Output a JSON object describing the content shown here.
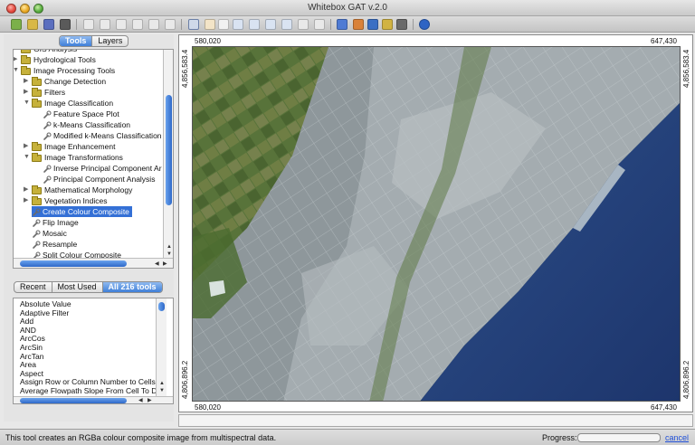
{
  "window": {
    "title": "Whitebox GAT v.2.0"
  },
  "tabs": {
    "tools": "Tools",
    "layers": "Layers",
    "active": "tools"
  },
  "tree": [
    {
      "label": "GIS Analysis",
      "indent": 0,
      "kind": "folder",
      "state": "collapsed"
    },
    {
      "label": "Hydrological Tools",
      "indent": 0,
      "kind": "folder",
      "state": "collapsed"
    },
    {
      "label": "Image Processing Tools",
      "indent": 0,
      "kind": "folder",
      "state": "expanded"
    },
    {
      "label": "Change Detection",
      "indent": 1,
      "kind": "folder",
      "state": "collapsed"
    },
    {
      "label": "Filters",
      "indent": 1,
      "kind": "folder",
      "state": "collapsed"
    },
    {
      "label": "Image Classification",
      "indent": 1,
      "kind": "folder",
      "state": "expanded"
    },
    {
      "label": "Feature Space Plot",
      "indent": 2,
      "kind": "tool"
    },
    {
      "label": "k-Means Classification",
      "indent": 2,
      "kind": "tool"
    },
    {
      "label": "Modified k-Means Classification",
      "indent": 2,
      "kind": "tool"
    },
    {
      "label": "Image Enhancement",
      "indent": 1,
      "kind": "folder",
      "state": "collapsed"
    },
    {
      "label": "Image Transformations",
      "indent": 1,
      "kind": "folder",
      "state": "expanded"
    },
    {
      "label": "Inverse Principal Component Ar",
      "indent": 2,
      "kind": "tool"
    },
    {
      "label": "Principal Component Analysis",
      "indent": 2,
      "kind": "tool"
    },
    {
      "label": "Mathematical Morphology",
      "indent": 1,
      "kind": "folder",
      "state": "collapsed"
    },
    {
      "label": "Vegetation Indices",
      "indent": 1,
      "kind": "folder",
      "state": "collapsed"
    },
    {
      "label": "Create Colour Composite",
      "indent": 1,
      "kind": "tool",
      "selected": true
    },
    {
      "label": "Flip Image",
      "indent": 1,
      "kind": "tool"
    },
    {
      "label": "Mosaic",
      "indent": 1,
      "kind": "tool"
    },
    {
      "label": "Resample",
      "indent": 1,
      "kind": "tool"
    },
    {
      "label": "Split Colour Composite",
      "indent": 1,
      "kind": "tool"
    }
  ],
  "list_tabs": {
    "recent": "Recent",
    "most_used": "Most Used",
    "all": "All 216 tools",
    "active": "all"
  },
  "tool_list": [
    "Absolute Value",
    "Adaptive Filter",
    "Add",
    "AND",
    "ArcCos",
    "ArcSin",
    "ArcTan",
    "Area",
    "Aspect",
    "Assign Row or Column Number to Cells",
    "Average Flowpath Slope From Cell To Divi"
  ],
  "map": {
    "x_left": "580,020",
    "x_right": "647,430",
    "y_top": "4,856,583.4",
    "y_bottom": "4,806,896.2"
  },
  "status": {
    "message": "This tool creates an RGBa colour composite image from multispectral data.",
    "progress_label": "Progress:",
    "progress": 0,
    "cancel": "cancel"
  },
  "colors": {
    "accent": "#3470d6",
    "lake": "#233f7a",
    "urban": "#9aa3a8",
    "vegetation": "#4e6a31"
  }
}
